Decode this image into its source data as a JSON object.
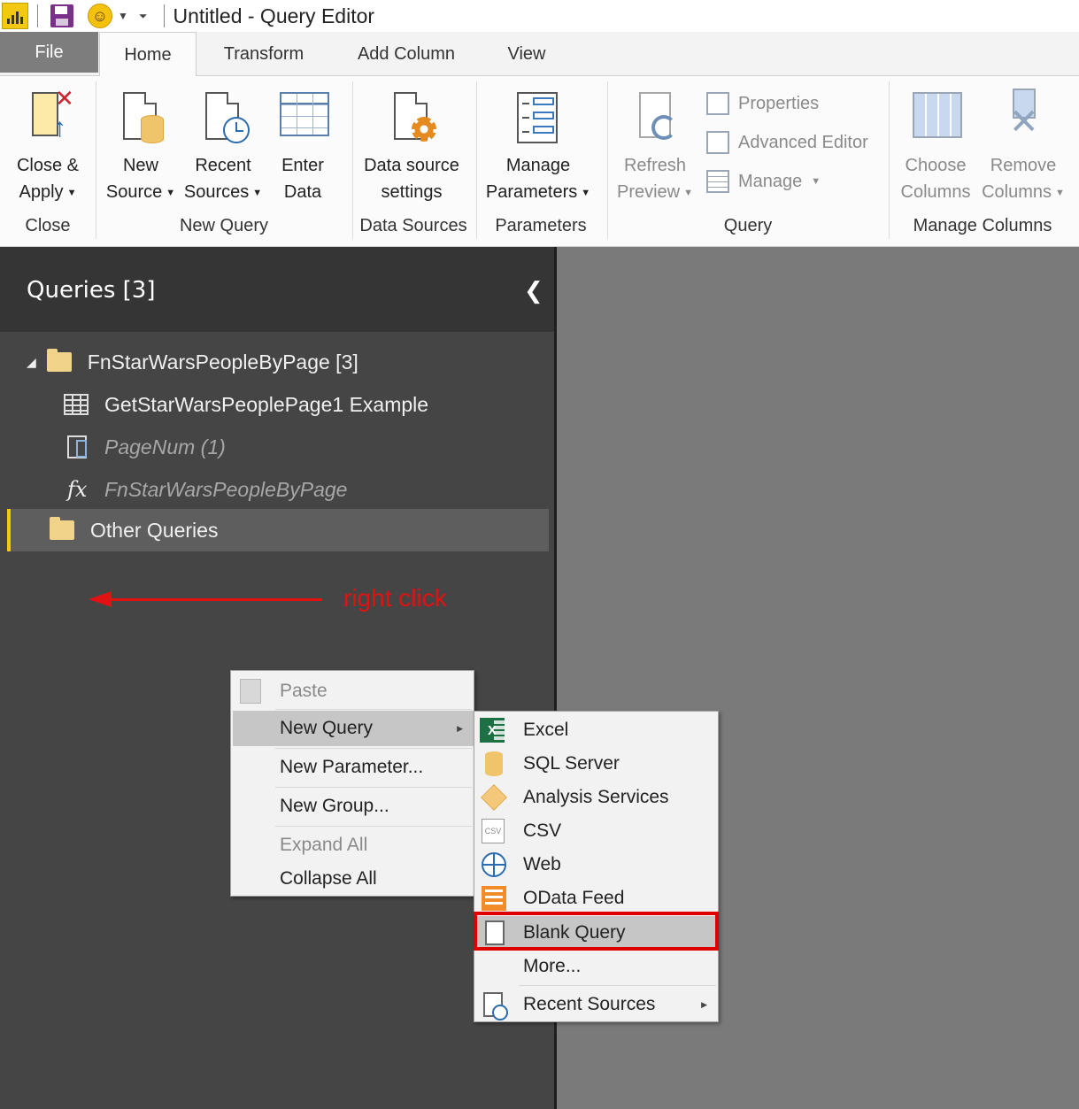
{
  "window": {
    "title": "Untitled - Query Editor"
  },
  "tabs": [
    "File",
    "Home",
    "Transform",
    "Add Column",
    "View"
  ],
  "ribbon": {
    "close_apply": {
      "line1": "Close &",
      "line2": "Apply"
    },
    "new_source": {
      "line1": "New",
      "line2": "Source"
    },
    "recent_sources": {
      "line1": "Recent",
      "line2": "Sources"
    },
    "enter_data": {
      "line1": "Enter",
      "line2": "Data"
    },
    "data_source_settings": {
      "line1": "Data source",
      "line2": "settings"
    },
    "manage_parameters": {
      "line1": "Manage",
      "line2": "Parameters"
    },
    "refresh_preview": {
      "line1": "Refresh",
      "line2": "Preview"
    },
    "properties": "Properties",
    "advanced_editor": "Advanced Editor",
    "manage": "Manage",
    "choose_columns": {
      "line1": "Choose",
      "line2": "Columns"
    },
    "remove_columns": {
      "line1": "Remove",
      "line2": "Columns"
    },
    "groups": {
      "close": "Close",
      "new_query": "New Query",
      "data_sources": "Data Sources",
      "parameters": "Parameters",
      "query": "Query",
      "manage_columns": "Manage Columns"
    }
  },
  "queries_pane": {
    "title": "Queries [3]",
    "items": [
      {
        "label": "FnStarWarsPeopleByPage [3]",
        "type": "folder"
      },
      {
        "label": "GetStarWarsPeoplePage1 Example",
        "type": "table"
      },
      {
        "label": "PageNum (1)",
        "type": "parameter"
      },
      {
        "label": "FnStarWarsPeopleByPage",
        "type": "function"
      },
      {
        "label": "Other Queries",
        "type": "folder"
      }
    ]
  },
  "annotation": {
    "text": "right click"
  },
  "context_menu": {
    "items": [
      "Paste",
      "New Query",
      "New Parameter...",
      "New Group...",
      "Expand All",
      "Collapse All"
    ]
  },
  "submenu": {
    "items": [
      "Excel",
      "SQL Server",
      "Analysis Services",
      "CSV",
      "Web",
      "OData Feed",
      "Blank Query",
      "More...",
      "Recent Sources"
    ],
    "excel_mark": "X",
    "csv_mark": "CSV"
  },
  "colors": {
    "accent": "#f2c811",
    "annotation_red": "#e01212",
    "pane_bg": "#454545",
    "canvas_bg": "#7a7a7a"
  }
}
